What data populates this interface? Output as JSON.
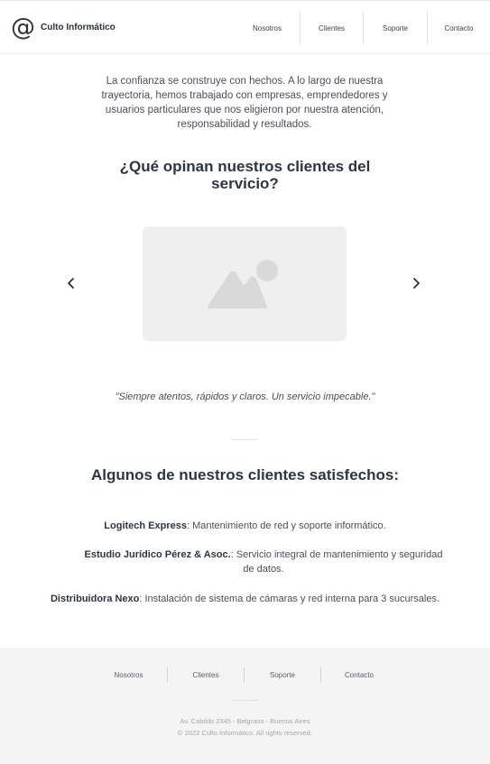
{
  "header": {
    "brand_symbol": "@",
    "brand_name": "Culto Informático",
    "nav": [
      "Nosotros",
      "Clientes",
      "Soporte",
      "Contacto"
    ]
  },
  "intro": {
    "text": "La confianza se construye con hechos. A lo largo de nuestra trayectoria, hemos trabajado con empresas, emprendedores y usuarios particulares que nos eligieron por nuestra atención, responsabilidad y resultados."
  },
  "testimonials": {
    "heading": "¿Qué opinan nuestros clientes del servicio?",
    "image_icon": "image-placeholder-icon",
    "prev_icon": "chevron-left-icon",
    "next_icon": "chevron-right-icon",
    "quote": "\"Siempre atentos, rápidos y claros. Un servicio impecable.\""
  },
  "clients": {
    "heading": "Algunos de nuestros clientes satisfechos:",
    "items": [
      {
        "name": "Logitech Express",
        "description": ": Mantenimiento de red y soporte informático."
      },
      {
        "name": "Estudio Jurídico Pérez & Asoc.",
        "description": ": Servicio integral de mantenimiento y seguridad de datos."
      },
      {
        "name": "Distribuidora Nexo",
        "description": ": Instalación de sistema de cámaras y red interna para 3 sucursales."
      }
    ]
  },
  "footer": {
    "nav": [
      "Nosotros",
      "Clientes",
      "Soporte",
      "Contacto"
    ],
    "address": "Av. Cabildo 2345 - Belgrano - Buenos Aires",
    "copyright": "© 2022 Culto Informático.  All rights reserved."
  },
  "colors": {
    "heading": "#2f3540",
    "text": "#4a4f57",
    "footer_bg": "#f4f4f4",
    "placeholder_bg": "#efefef",
    "placeholder_icon": "#d9d9d9"
  }
}
